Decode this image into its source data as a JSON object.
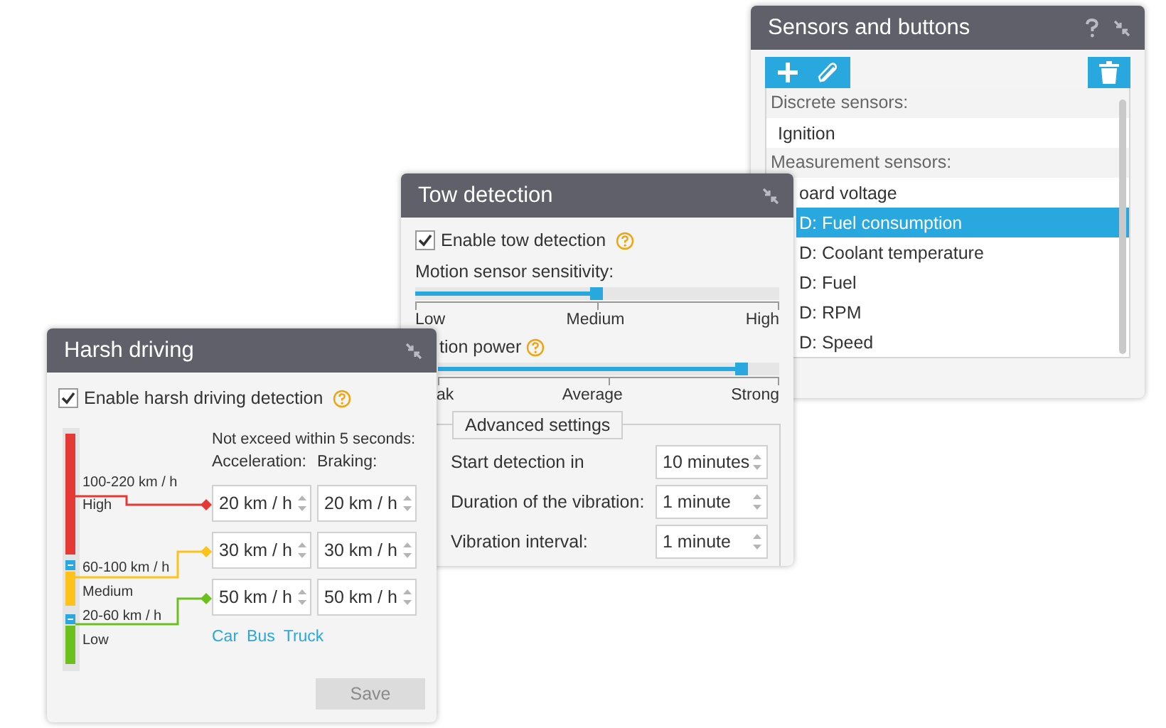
{
  "sensors_window": {
    "title": "Sensors and buttons",
    "sections": [
      {
        "heading": "Discrete sensors:",
        "items": [
          {
            "label": "Ignition",
            "selected": false
          }
        ]
      },
      {
        "heading": "Measurement sensors:",
        "items": [
          {
            "label": "oard voltage",
            "selected": false
          },
          {
            "label": "D: Fuel consumption",
            "selected": true
          },
          {
            "label": "D: Coolant temperature",
            "selected": false
          },
          {
            "label": "D: Fuel",
            "selected": false
          },
          {
            "label": "D: RPM",
            "selected": false
          },
          {
            "label": "D: Speed",
            "selected": false
          }
        ]
      }
    ]
  },
  "tow_window": {
    "title": "Tow detection",
    "enable": {
      "label": "Enable tow detection",
      "checked": true
    },
    "sliders": [
      {
        "label": "Motion sensor sensitivity:",
        "help": false,
        "level": 0.5,
        "ticks": [
          "Low",
          "Medium",
          "High"
        ]
      },
      {
        "label": "tion power",
        "help": true,
        "level": 0.89,
        "ticks": [
          "ak",
          "Average",
          "Strong"
        ]
      }
    ],
    "advanced": {
      "label": "Advanced settings",
      "rows": [
        {
          "label": "Start detection in",
          "value": "10 minutes"
        },
        {
          "label": "Duration of the vibration:",
          "value": "1 minute"
        },
        {
          "label": "Vibration interval:",
          "value": "1 minute"
        }
      ]
    }
  },
  "harsh_window": {
    "title": "Harsh driving",
    "enable": {
      "label": "Enable harsh driving detection",
      "checked": true
    },
    "heading": "Not exceed within 5 seconds:",
    "columns": [
      "Acceleration:",
      "Braking:"
    ],
    "levels": [
      {
        "range": "100-220 km / h",
        "name": "High",
        "color": "#e53935",
        "acceleration": "20 km / h",
        "braking": "20 km / h"
      },
      {
        "range": "60-100 km / h",
        "name": "Medium",
        "color": "#fdc21c",
        "acceleration": "30 km / h",
        "braking": "30 km / h"
      },
      {
        "range": "20-60 km / h",
        "name": "Low",
        "color": "#6cc01e",
        "acceleration": "50 km / h",
        "braking": "50 km / h"
      }
    ],
    "presets": [
      "Car",
      "Bus",
      "Truck"
    ],
    "save": {
      "label": "Save",
      "disabled": true
    }
  }
}
